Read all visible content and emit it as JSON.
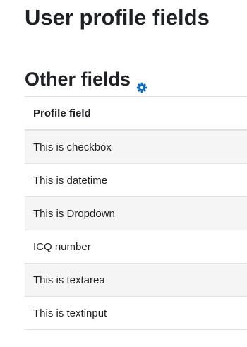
{
  "page": {
    "title": "User profile fields"
  },
  "section": {
    "heading": "Other fields",
    "settings_icon": "gear-icon",
    "accent_color": "#0f6cbf"
  },
  "table": {
    "header": "Profile field",
    "rows": [
      "This is checkbox",
      "This is datetime",
      "This is Dropdown",
      "ICQ number",
      "This is textarea",
      "This is textinput"
    ]
  }
}
